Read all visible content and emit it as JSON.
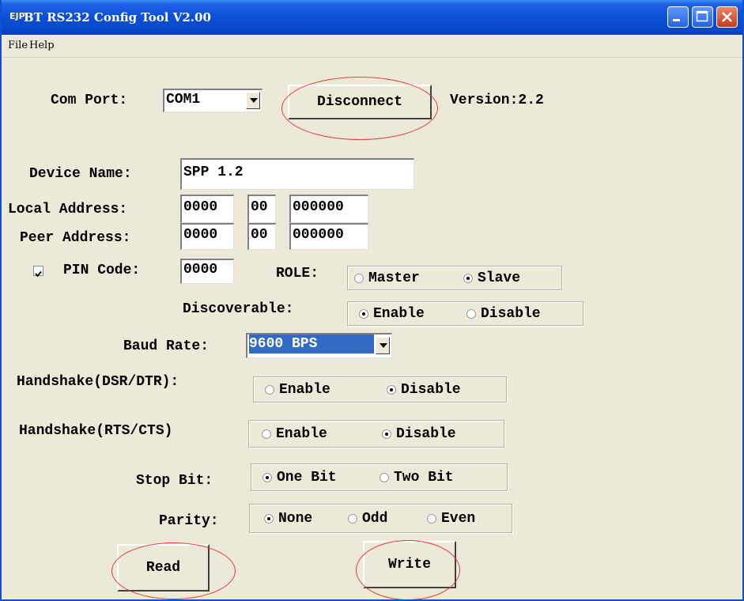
{
  "window": {
    "title": "BT RS232 Config Tool  V2.00",
    "icon_text": "EJP"
  },
  "menu": {
    "file": "File",
    "help": "Help"
  },
  "com_port": {
    "label": "Com Port:",
    "value": "COM1"
  },
  "disconnect_label": "Disconnect",
  "version_label": "Version:2.2",
  "device_name": {
    "label": "Device Name:",
    "value": "SPP 1.2"
  },
  "local_address": {
    "label": "Local Address:",
    "part1": "0000",
    "part2": "00",
    "part3": "000000"
  },
  "peer_address": {
    "label": "Peer Address:",
    "part1": "0000",
    "part2": "00",
    "part3": "000000"
  },
  "pin_code": {
    "label": "PIN Code:",
    "value": "0000",
    "checked": true
  },
  "role": {
    "label": "ROLE:",
    "options": [
      "Master",
      "Slave"
    ],
    "selected": "Slave"
  },
  "discoverable": {
    "label": "Discoverable:",
    "options": [
      "Enable",
      "Disable"
    ],
    "selected": "Enable"
  },
  "baud_rate": {
    "label": "Baud Rate:",
    "value": "9600 BPS"
  },
  "handshake_dsr": {
    "label": "Handshake(DSR/DTR):",
    "options": [
      "Enable",
      "Disable"
    ],
    "selected": "Disable"
  },
  "handshake_rts": {
    "label": "Handshake(RTS/CTS)",
    "options": [
      "Enable",
      "Disable"
    ],
    "selected": "Disable"
  },
  "stop_bit": {
    "label": "Stop Bit:",
    "options": [
      "One Bit",
      "Two Bit"
    ],
    "selected": "One Bit"
  },
  "parity": {
    "label": "Parity:",
    "options": [
      "None",
      "Odd",
      "Even"
    ],
    "selected": "None"
  },
  "read_label": "Read",
  "write_label": "Write",
  "colors": {
    "titlebar": "#0b4fd6",
    "window_bg": "#ece9d8",
    "selection": "#316ac5",
    "annotation": "#e53a3a"
  }
}
